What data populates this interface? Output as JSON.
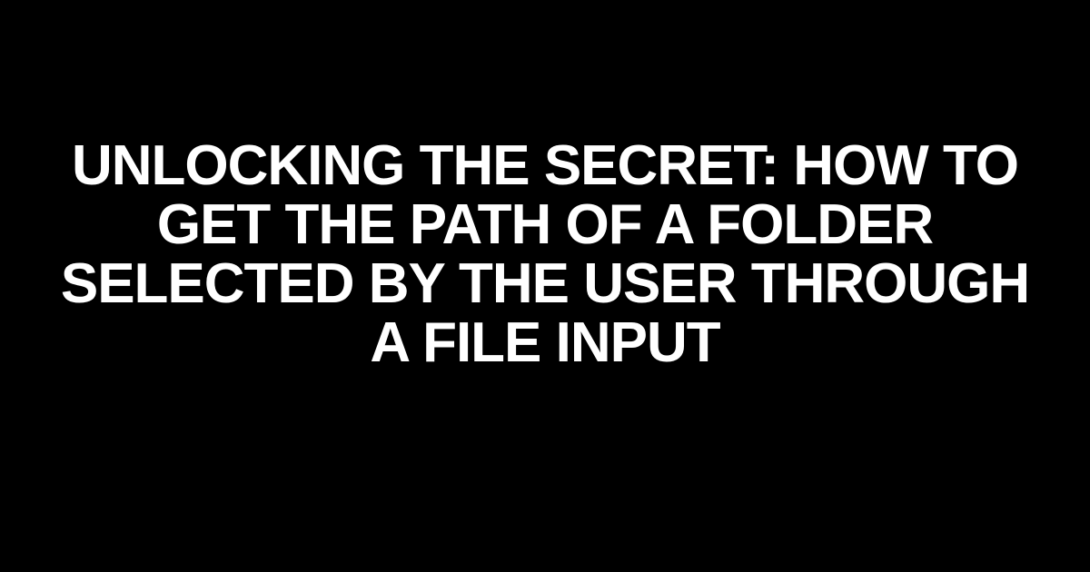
{
  "title": "UNLOCKING THE SECRET: HOW TO GET THE PATH OF A FOLDER SELECTED BY THE USER THROUGH A FILE INPUT"
}
